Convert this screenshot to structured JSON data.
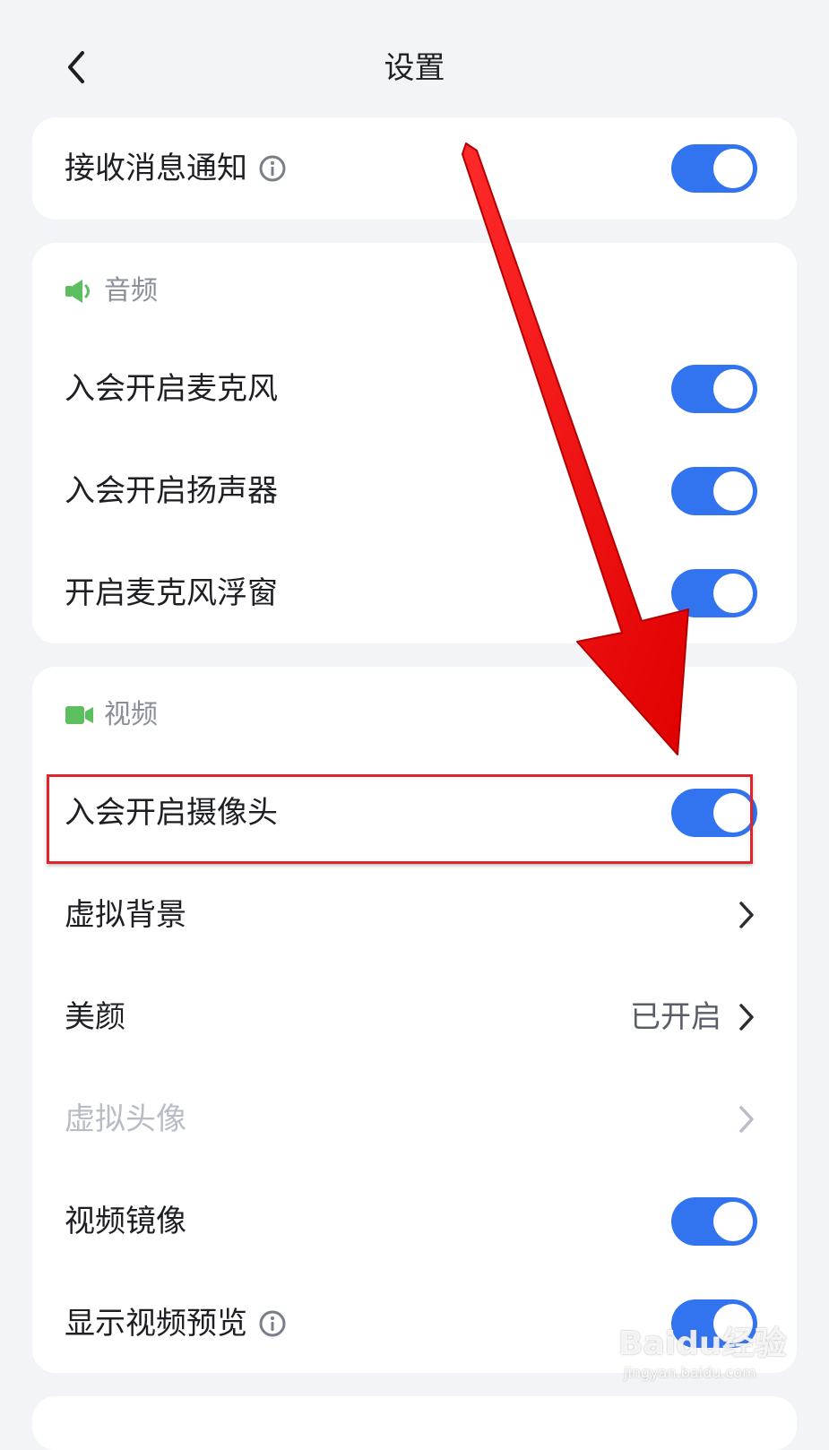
{
  "header": {
    "title": "设置"
  },
  "notification": {
    "label": "接收消息通知",
    "enabled": true
  },
  "audio": {
    "section_title": "音频",
    "items": [
      {
        "label": "入会开启麦克风",
        "enabled": true
      },
      {
        "label": "入会开启扬声器",
        "enabled": true
      },
      {
        "label": "开启麦克风浮窗",
        "enabled": true
      }
    ]
  },
  "video": {
    "section_title": "视频",
    "camera": {
      "label": "入会开启摄像头",
      "enabled": true
    },
    "virtual_background": {
      "label": "虚拟背景"
    },
    "beauty": {
      "label": "美颜",
      "value": "已开启"
    },
    "virtual_avatar": {
      "label": "虚拟头像",
      "disabled": true
    },
    "mirror": {
      "label": "视频镜像",
      "enabled": true
    },
    "preview": {
      "label": "显示视频预览",
      "enabled": true
    }
  },
  "watermark": {
    "brand": "Baidu经验",
    "url": "jingyan.baidu.com"
  },
  "colors": {
    "accent": "#3273f0",
    "section_icon": "#5bbf5f",
    "annotation": "#e0252a",
    "background": "#f3f4f8"
  },
  "icons": {
    "back": "chevron-left-icon",
    "info": "info-icon",
    "audio": "speaker-icon",
    "video": "video-camera-icon",
    "next": "chevron-right-icon"
  }
}
